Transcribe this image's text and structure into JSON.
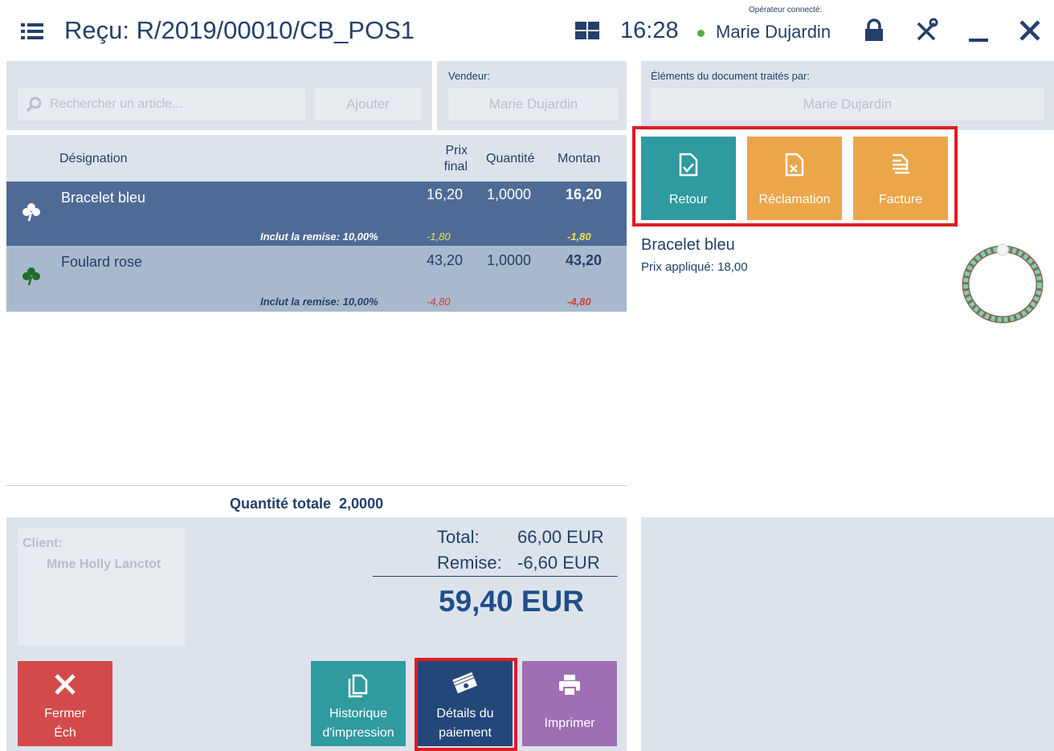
{
  "header": {
    "title": "Reçu: R/2019/00010/CB_POS1",
    "time": "16:28",
    "operator_label": "Opérateur connecté:",
    "operator_name": "Marie Dujardin"
  },
  "search": {
    "placeholder": "Rechercher un article...",
    "add_label": "Ajouter"
  },
  "seller": {
    "label": "Vendeur:",
    "value": "Marie Dujardin"
  },
  "processed_by": {
    "label": "Éléments du document traités par:",
    "value": "Marie Dujardin"
  },
  "table": {
    "headers": {
      "designation": "Désignation",
      "final_price_1": "Prix",
      "final_price_2": "final",
      "quantity": "Quantité",
      "amount": "Montan"
    },
    "rows": [
      {
        "name": "Bracelet bleu",
        "price": "16,20",
        "qty": "1,0000",
        "amount": "16,20",
        "discount_note": "Inclut la remise: 10,00%",
        "discount_price": "-1,80",
        "discount_amount": "-1,80"
      },
      {
        "name": "Foulard rose",
        "price": "43,20",
        "qty": "1,0000",
        "amount": "43,20",
        "discount_note": "Inclut la remise: 10,00%",
        "discount_price": "-4,80",
        "discount_amount": "-4,80"
      }
    ],
    "total_qty_label": "Quantité totale",
    "total_qty": "2,0000"
  },
  "client": {
    "label": "Client:",
    "name": "Mme Holly Lanctot"
  },
  "summary": {
    "total_label": "Total:",
    "total_value": "66,00 EUR",
    "discount_label": "Remise:",
    "discount_value": "-6,60 EUR",
    "grand_total": "59,40 EUR"
  },
  "buttons": {
    "close_1": "Fermer",
    "close_2": "Éch",
    "history_1": "Historique",
    "history_2": "d'impression",
    "payment_1": "Détails du",
    "payment_2": "paiement",
    "print": "Imprimer"
  },
  "actions": {
    "return": "Retour",
    "complaint": "Réclamation",
    "invoice": "Facture"
  },
  "product": {
    "name": "Bracelet bleu",
    "price_label": "Prix appliqué:",
    "price": "18,00"
  },
  "colors": {
    "selected_row": "#4e6b96",
    "alt_row": "#a9b9cd",
    "close_button": "#d34a4a",
    "history_button": "#2f9aa0",
    "payment_button": "#24477a",
    "print_button": "#a06fb3",
    "return_button": "#2f9aa0",
    "complaint_button": "#eba64a",
    "invoice_button": "#eba64a",
    "highlight": "#e01c24"
  }
}
